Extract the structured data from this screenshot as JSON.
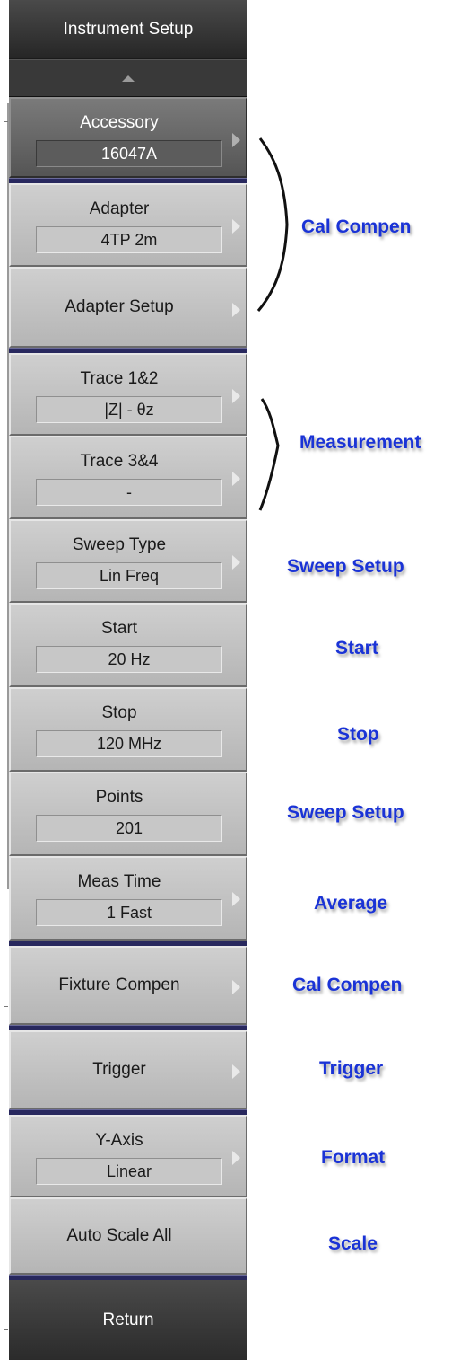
{
  "panel": {
    "title": "Instrument Setup"
  },
  "keys": [
    {
      "label": "Accessory",
      "value": "16047A",
      "has_submenu": true
    },
    {
      "label": "Adapter",
      "value": "4TP 2m",
      "has_submenu": true
    },
    {
      "label": "Adapter Setup",
      "has_submenu": true
    },
    {
      "label": "Trace 1&2",
      "value": "|Z| - θz",
      "has_submenu": true
    },
    {
      "label": "Trace 3&4",
      "value": "-",
      "has_submenu": true
    },
    {
      "label": "Sweep Type",
      "value": "Lin Freq",
      "has_submenu": true
    },
    {
      "label": "Start",
      "value": "20 Hz",
      "has_submenu": false
    },
    {
      "label": "Stop",
      "value": "120 MHz",
      "has_submenu": false
    },
    {
      "label": "Points",
      "value": "201",
      "has_submenu": false
    },
    {
      "label": "Meas Time",
      "value": "1 Fast",
      "has_submenu": true
    },
    {
      "label": "Fixture Compen",
      "has_submenu": true
    },
    {
      "label": "Trigger",
      "has_submenu": true
    },
    {
      "label": "Y-Axis",
      "value": "Linear",
      "has_submenu": true
    },
    {
      "label": "Auto Scale All",
      "has_submenu": false
    }
  ],
  "return_label": "Return",
  "annotations": {
    "cal_compen_group": "Cal Compen",
    "measurement_group": "Measurement",
    "sweep_type": "Sweep Setup",
    "start": "Start",
    "stop": "Stop",
    "points": "Sweep Setup",
    "meas_time": "Average",
    "fixture_compen": "Cal Compen",
    "trigger": "Trigger",
    "y_axis": "Format",
    "auto_scale": "Scale"
  },
  "colors": {
    "annotation_text": "#1a33d6",
    "separator": "#28285e",
    "key_face": "#c2c2c2",
    "title_bar": "#333333"
  }
}
